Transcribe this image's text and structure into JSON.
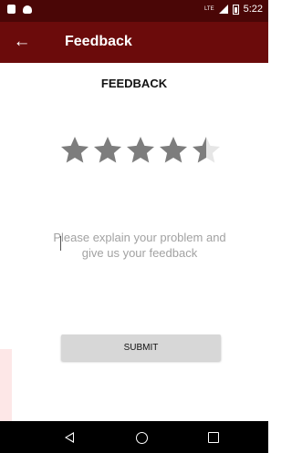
{
  "status_bar": {
    "network_label": "LTE",
    "time": "5:22"
  },
  "app_bar": {
    "title": "Feedback"
  },
  "main": {
    "heading": "FEEDBACK",
    "rating": {
      "value": 4.5,
      "max": 5,
      "filled_color": "#7d7d7d",
      "empty_color": "#e6e6e6"
    },
    "feedback_input": {
      "placeholder": "Please explain your problem and give us your feedback",
      "value": ""
    },
    "submit_label": "SUBMIT"
  },
  "colors": {
    "status_bar_bg": "#4a0606",
    "app_bar_bg": "#6b0b0b",
    "button_bg": "#d7d7d7"
  }
}
